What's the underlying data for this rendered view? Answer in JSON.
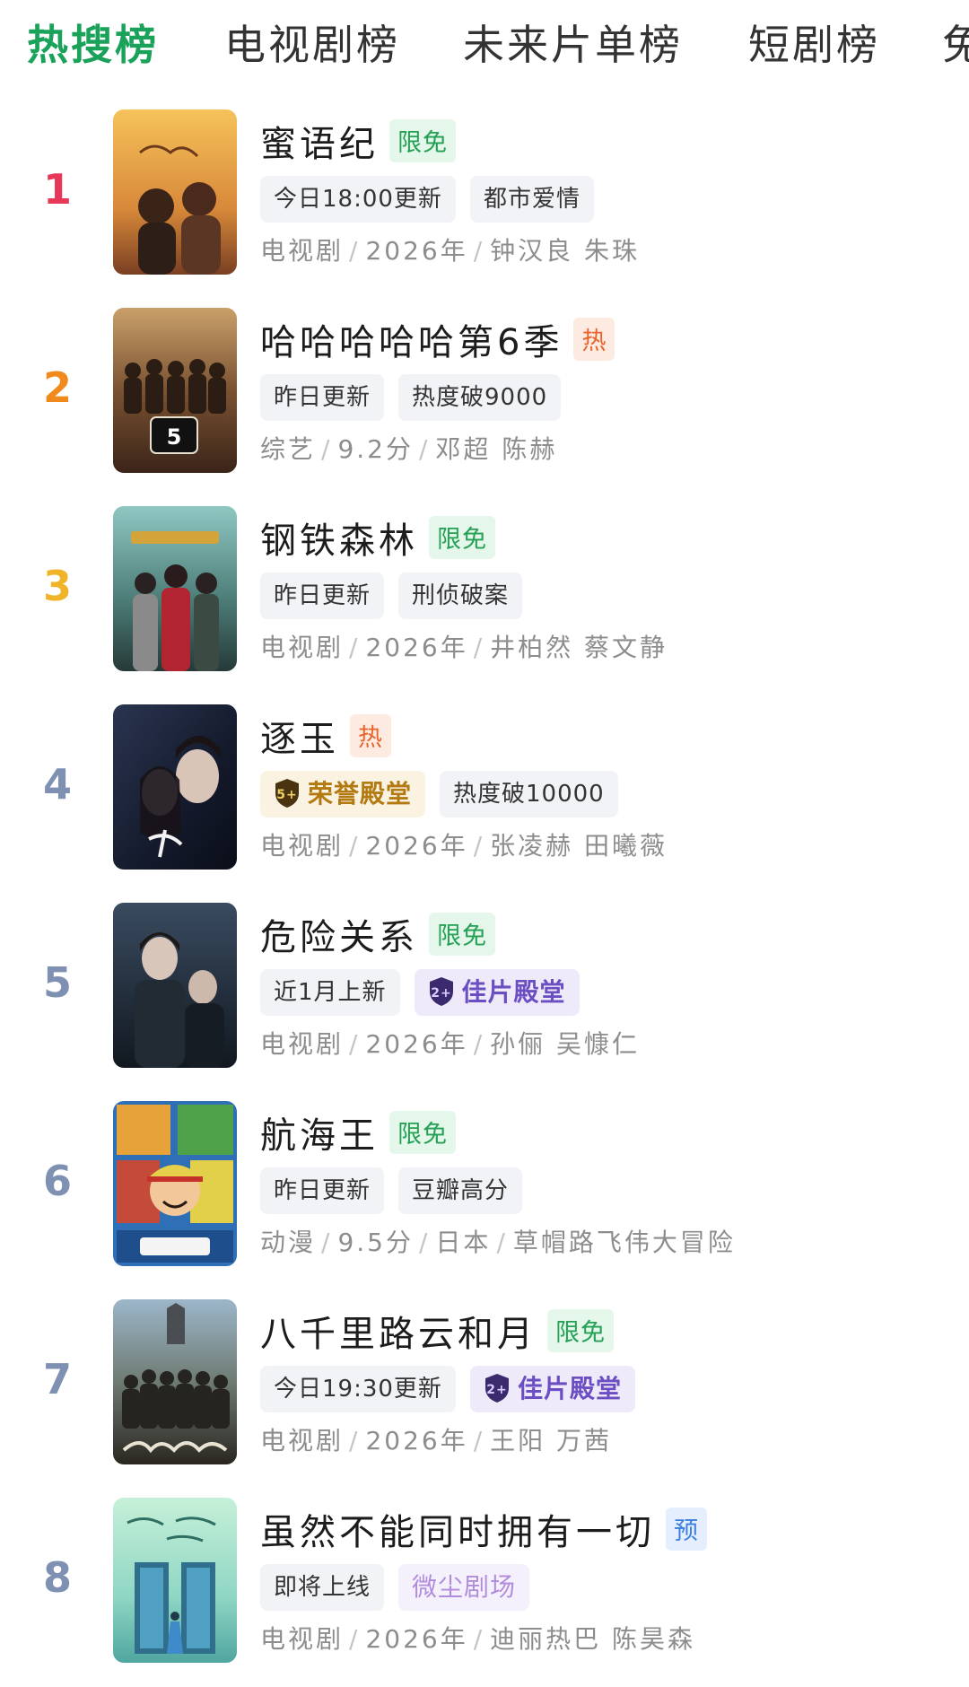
{
  "tabs": [
    {
      "label": "热搜榜",
      "active": true
    },
    {
      "label": "电视剧榜",
      "active": false
    },
    {
      "label": "未来片单榜",
      "active": false
    },
    {
      "label": "短剧榜",
      "active": false
    },
    {
      "label": "免",
      "active": false
    }
  ],
  "colors": {
    "active_tab": "#1aa25a",
    "rank_1": "#e8385a",
    "rank_2": "#f08a1c",
    "rank_3": "#f0b428",
    "rank_other": "#7f91b3"
  },
  "items": [
    {
      "rank": "1",
      "title": "蜜语纪",
      "mark": "限免",
      "tags": [
        "今日18:00更新",
        "都市爱情"
      ],
      "meta": [
        "电视剧",
        "2026年",
        "钟汉良 朱珠"
      ]
    },
    {
      "rank": "2",
      "title": "哈哈哈哈哈第6季",
      "mark": "热",
      "tags": [
        "昨日更新",
        "热度破9000"
      ],
      "meta": [
        "综艺",
        "9.2分",
        "邓超 陈赫"
      ]
    },
    {
      "rank": "3",
      "title": "钢铁森林",
      "mark": "限免",
      "tags": [
        "昨日更新",
        "刑侦破案"
      ],
      "meta": [
        "电视剧",
        "2026年",
        "井柏然 蔡文静"
      ]
    },
    {
      "rank": "4",
      "title": "逐玉",
      "mark": "热",
      "tags": [
        "荣誉殿堂",
        "热度破10000"
      ],
      "meta": [
        "电视剧",
        "2026年",
        "张凌赫 田曦薇"
      ]
    },
    {
      "rank": "5",
      "title": "危险关系",
      "mark": "限免",
      "tags": [
        "近1月上新",
        "佳片殿堂"
      ],
      "meta": [
        "电视剧",
        "2026年",
        "孙俪 吴慷仁"
      ]
    },
    {
      "rank": "6",
      "title": "航海王",
      "mark": "限免",
      "tags": [
        "昨日更新",
        "豆瓣高分"
      ],
      "meta": [
        "动漫",
        "9.5分",
        "日本",
        "草帽路飞伟大冒险"
      ]
    },
    {
      "rank": "7",
      "title": "八千里路云和月",
      "mark": "限免",
      "tags": [
        "今日19:30更新",
        "佳片殿堂"
      ],
      "meta": [
        "电视剧",
        "2026年",
        "王阳 万茜"
      ]
    },
    {
      "rank": "8",
      "title": "虽然不能同时拥有一切",
      "mark": "预",
      "tags": [
        "即将上线",
        "微尘剧场"
      ],
      "meta": [
        "电视剧",
        "2026年",
        "迪丽热巴 陈昊森"
      ]
    }
  ],
  "badges": {
    "honor_level": "5+",
    "fine_level": "2+"
  }
}
